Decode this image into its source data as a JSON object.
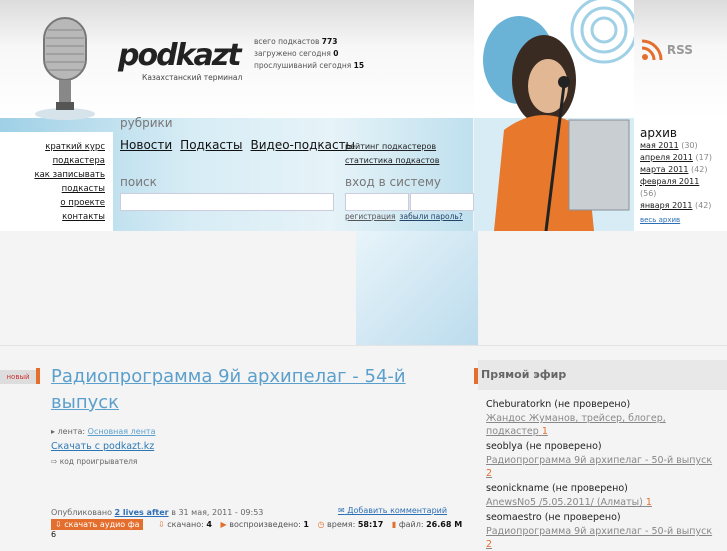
{
  "header": {
    "brand": "podkazt",
    "tagline": "Казахстанский терминал",
    "stats": [
      {
        "label": "всего подкастов",
        "value": "773"
      },
      {
        "label": "загружено сегодня",
        "value": "0"
      },
      {
        "label": "прослушиваний сегодня",
        "value": "15"
      }
    ],
    "rss_label": "RSS"
  },
  "leftnav": [
    "краткий курс",
    "подкастера",
    "как записывать",
    "подкасты",
    "о проекте",
    "контакты"
  ],
  "categories": {
    "title": "рубрики",
    "items": [
      "Новости",
      "Подкасты",
      "Видео-подкасты"
    ]
  },
  "ratings": [
    "рейтинг подкастеров",
    "статистика подкастов"
  ],
  "search": {
    "title": "поиск",
    "placeholder": ""
  },
  "login": {
    "title": "вход в систему",
    "register": "регистрация",
    "forgot": "забыли пароль?"
  },
  "archive": {
    "title": "архив",
    "items": [
      {
        "month": "мая 2011",
        "count": "(30)"
      },
      {
        "month": "апреля 2011",
        "count": "(17)"
      },
      {
        "month": "марта 2011",
        "count": "(42)"
      },
      {
        "month": "февраля 2011",
        "count": "(56)"
      },
      {
        "month": "января 2011",
        "count": "(42)"
      }
    ],
    "all": "весь архив"
  },
  "post": {
    "badge": "новый",
    "title": "Радиопрограмма 9й архипелаг - 54-й выпуск",
    "feed_label": "лента:",
    "feed_value": "Основная лента",
    "download": "Скачать с podkazt.kz",
    "player_code": "код проигрывателя",
    "published_prefix": "Опубликовано",
    "author": "2 lives after",
    "published_suffix": "в 31 мая, 2011 - 09:53",
    "add_comment": "Добавить комментарий",
    "download_audio": "скачать аудио фа",
    "downloaded_label": "скачано:",
    "downloaded": "4",
    "played_label": "воспроизведено:",
    "played": "1",
    "time_label": "время:",
    "time": "58:17",
    "file_label": "файл:",
    "file": "26.68 M",
    "extra": "6"
  },
  "live": {
    "title": "Прямой эфир",
    "items": [
      {
        "who": "Cheburatorkn (не проверено)",
        "what": "Жандос Жуманов, трейсер, блогер, подкастер",
        "num": "1"
      },
      {
        "who": "seoblya (не проверено)",
        "what": "Радиопрограмма 9й архипелаг - 50-й выпуск",
        "num": "2"
      },
      {
        "who": "seonickname (не проверено)",
        "what": "AnewsNo5 /5.05.2011/ (Алматы)",
        "num": "1"
      },
      {
        "who": "seomaestro (не проверено)",
        "what": "Радиопрограмма 9й архипелаг - 50-й выпуск",
        "num": "2"
      }
    ]
  },
  "colors": {
    "accent": "#e46e2e",
    "link_blue": "#5b9fcc",
    "band_blue": "#9fd0e6"
  }
}
